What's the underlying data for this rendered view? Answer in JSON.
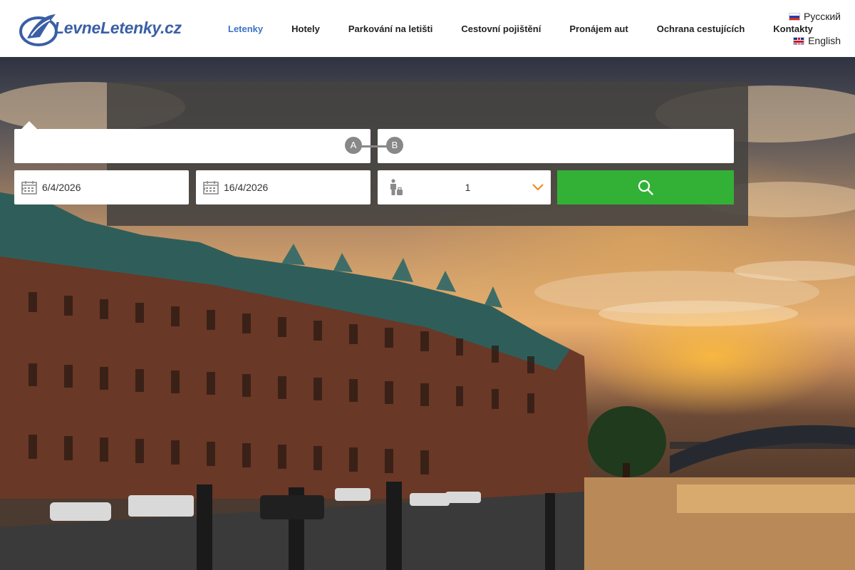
{
  "header": {
    "logo_text": "LevneLetenky.cz",
    "nav": [
      {
        "label": "Letenky",
        "active": true
      },
      {
        "label": "Hotely",
        "active": false
      },
      {
        "label": "Parkování na letišti",
        "active": false
      },
      {
        "label": "Cestovní pojištění",
        "active": false
      },
      {
        "label": "Pronájem aut",
        "active": false
      },
      {
        "label": "Ochrana cestujících",
        "active": false
      },
      {
        "label": "Kontakty",
        "active": false
      }
    ],
    "languages": [
      {
        "label": "Русский",
        "flag": "ru-flag-icon"
      },
      {
        "label": "English",
        "flag": "gb-flag-icon"
      }
    ]
  },
  "search": {
    "from": {
      "value": "",
      "pin": "A"
    },
    "to": {
      "value": "",
      "pin": "B"
    },
    "depart_date": "6/4/2026",
    "return_date": "16/4/2026",
    "passengers": "1",
    "icons": {
      "date": "calendar-icon",
      "passengers": "person-luggage-icon",
      "dropdown": "chevron-down-icon",
      "search": "search-icon"
    }
  },
  "colors": {
    "nav_active": "#3b74c4",
    "search_button": "#33b136",
    "dropdown_arrow": "#f08a24",
    "panel": "#444240"
  }
}
